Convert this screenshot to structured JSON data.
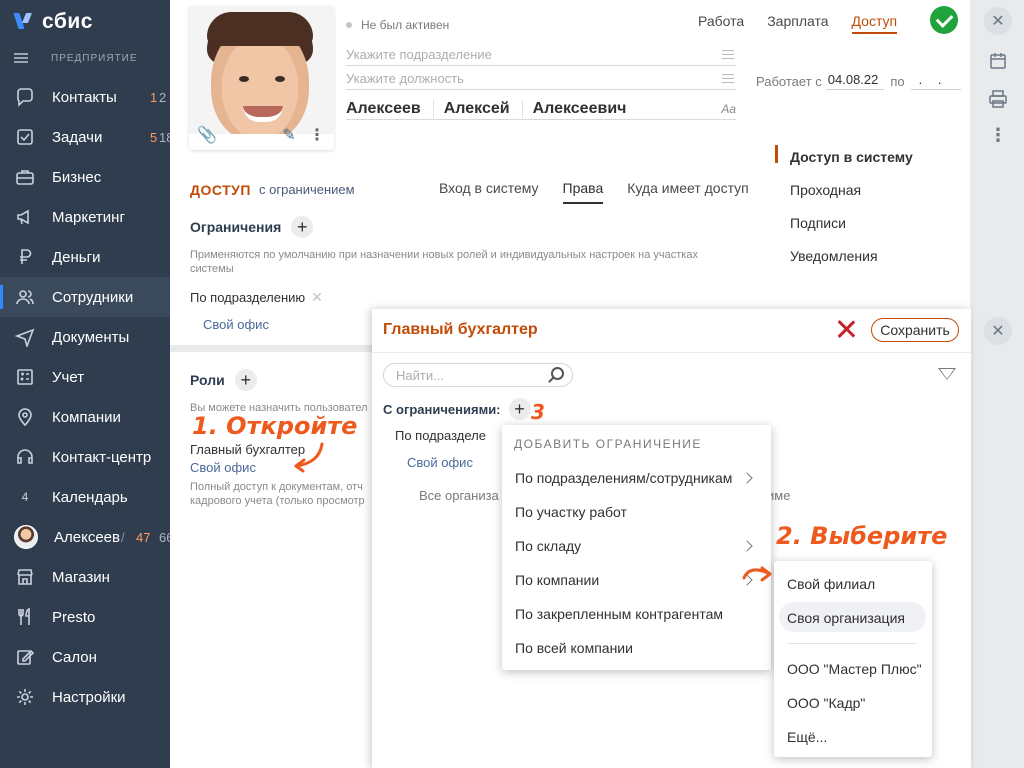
{
  "app": {
    "name": "сбис",
    "enterprise": "ПРЕДПРИЯТИЕ"
  },
  "sidebar": {
    "items": [
      {
        "label": "Контакты",
        "badge": "1",
        "badge2": "2"
      },
      {
        "label": "Задачи",
        "badge": "5",
        "badge2": "18"
      },
      {
        "label": "Бизнес"
      },
      {
        "label": "Маркетинг"
      },
      {
        "label": "Деньги"
      },
      {
        "label": "Сотрудники",
        "active": true
      },
      {
        "label": "Документы"
      },
      {
        "label": "Учет"
      },
      {
        "label": "Компании"
      },
      {
        "label": "Контакт-центр"
      },
      {
        "label": "Календарь",
        "num": "4"
      },
      {
        "label": "Алексеев",
        "badge": "47",
        "badge2": "66"
      },
      {
        "label": "Магазин"
      },
      {
        "label": "Presto"
      },
      {
        "label": "Салон"
      },
      {
        "label": "Настройки"
      }
    ]
  },
  "employee": {
    "status": "Не был активен",
    "department_placeholder": "Укажите подразделение",
    "position_placeholder": "Укажите должность",
    "last_name": "Алексеев",
    "first_name": "Алексей",
    "middle_name": "Алексеевич",
    "font_toggle": "Аа",
    "works_from_label": "Работает с",
    "works_from": "04.08.22",
    "works_to_label": "по",
    "works_to": ". ."
  },
  "top_tabs": [
    "Работа",
    "Зарплата",
    "Доступ"
  ],
  "access": {
    "title": "ДОСТУП",
    "subtitle": "с ограничением",
    "tabs": [
      "Вход в систему",
      "Права",
      "Куда имеет доступ"
    ],
    "restrictions_title": "Ограничения",
    "restrictions_note": "Применяются по умолчанию при назначении новых ролей и индивидуальных настроек на участках системы",
    "by_department": "По подразделению",
    "own_office": "Свой офис",
    "roles_title": "Роли",
    "roles_note": "Вы можете назначить пользовател",
    "role_name": "Главный бухгалтер",
    "role_office": "Свой офис",
    "role_note": "Полный доступ к документам, отч",
    "role_note2": "кадрового учета (только просмотр"
  },
  "right_menu": [
    "Доступ в систему",
    "Проходная",
    "Подписи",
    "Уведомления"
  ],
  "annotations": {
    "step1": "1. Откройте",
    "step2": "2. Выберите",
    "step3": "3"
  },
  "popup": {
    "title": "Главный бухгалтер",
    "save": "Сохранить",
    "search_placeholder": "Найти...",
    "with_restrictions": "С ограничениями:",
    "by_department": "По подразделе",
    "own_office": "Свой офис",
    "all_orgs": "Все организа",
    "all_orgs_tail": "име"
  },
  "dropdown": {
    "header": "ДОБАВИТЬ ОГРАНИЧЕНИЕ",
    "items": [
      "По подразделениям/сотрудникам",
      "По участку работ",
      "По складу",
      "По компании",
      "По закрепленным контрагентам",
      "По всей компании"
    ]
  },
  "submenu": {
    "items": [
      "Свой филиал",
      "Своя организация",
      "ООО \"Мастер Плюс\"",
      "ООО \"Кадр\"",
      "Ещё..."
    ]
  },
  "colors": {
    "accent": "#c24b06",
    "sidebar": "#2f3d4e",
    "ok": "#1fa33a",
    "annotation": "#ee5a1d"
  }
}
